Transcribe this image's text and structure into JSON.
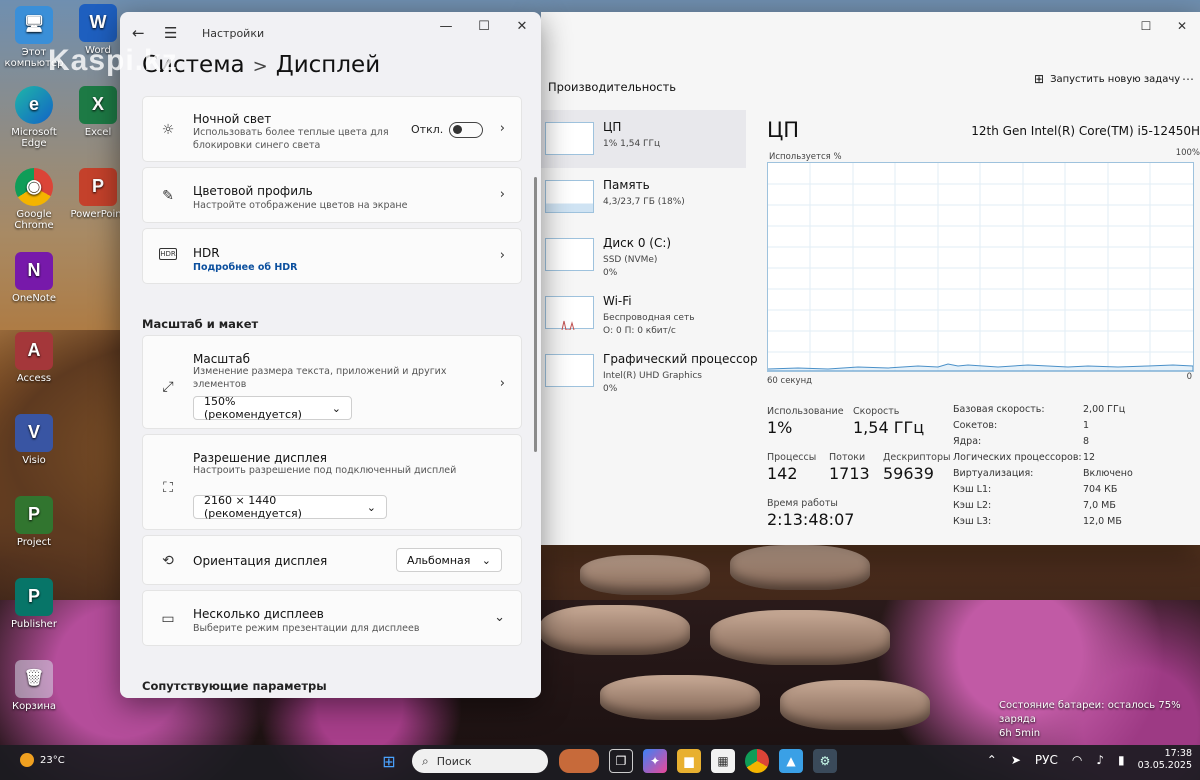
{
  "desktop": {
    "icons": [
      {
        "label": "Этот компьютер",
        "glyph": "🖥"
      },
      {
        "label": "Word",
        "glyph": "W"
      },
      {
        "label": "Microsoft Edge",
        "glyph": "e"
      },
      {
        "label": "Excel",
        "glyph": "X"
      },
      {
        "label": "Google Chrome",
        "glyph": "◉"
      },
      {
        "label": "PowerPoint",
        "glyph": "P"
      },
      {
        "label": "OneNote",
        "glyph": "N"
      },
      {
        "label": "Access",
        "glyph": "A"
      },
      {
        "label": "Visio",
        "glyph": "V"
      },
      {
        "label": "Project",
        "glyph": "P"
      },
      {
        "label": "Publisher",
        "glyph": "P"
      },
      {
        "label": "Корзина",
        "glyph": "🗑"
      }
    ],
    "watermark": "Kaspi.kz"
  },
  "settings": {
    "window_title": "Настройки",
    "breadcrumb_parent": "Система",
    "breadcrumb_sep": ">",
    "breadcrumb_current": "Дисплей",
    "night_light": {
      "title": "Ночной свет",
      "desc": "Использовать более теплые цвета для блокировки синего света",
      "state": "Откл."
    },
    "color_profile": {
      "title": "Цветовой профиль",
      "desc": "Настройте отображение цветов на экране"
    },
    "hdr": {
      "title": "HDR",
      "link": "Подробнее об HDR"
    },
    "section_scale": "Масштаб и макет",
    "scale": {
      "title": "Масштаб",
      "desc": "Изменение размера текста, приложений и других элементов",
      "value": "150% (рекомендуется)"
    },
    "resolution": {
      "title": "Разрешение дисплея",
      "desc": "Настроить разрешение под подключенный дисплей",
      "value": "2160 × 1440 (рекомендуется)"
    },
    "orientation": {
      "title": "Ориентация дисплея",
      "value": "Альбомная"
    },
    "multi": {
      "title": "Несколько дисплеев",
      "desc": "Выберите режим презентации для дисплеев"
    },
    "section_related": "Сопутствующие параметры"
  },
  "taskmgr": {
    "tab_title": "Производительность",
    "run_task": "Запустить новую задачу",
    "resources": [
      {
        "name": "ЦП",
        "sub1": "1% 1,54 ГГц",
        "sub2": ""
      },
      {
        "name": "Память",
        "sub1": "4,3/23,7 ГБ (18%)",
        "sub2": ""
      },
      {
        "name": "Диск 0 (C:)",
        "sub1": "SSD (NVMe)",
        "sub2": "0%"
      },
      {
        "name": "Wi-Fi",
        "sub1": "Беспроводная сеть",
        "sub2": "О: 0 П: 0 кбит/с"
      },
      {
        "name": "Графический процессор",
        "sub1": "Intel(R) UHD Graphics",
        "sub2": "0%"
      }
    ],
    "cpu": {
      "title": "ЦП",
      "model": "12th Gen Intel(R) Core(TM) i5-12450H",
      "util_label": "Используется %",
      "util_max": "100%",
      "x_left": "60 секунд",
      "x_right": "0",
      "stats": {
        "usage_label": "Использование",
        "usage": "1%",
        "speed_label": "Скорость",
        "speed": "1,54 ГГц",
        "proc_label": "Процессы",
        "proc": "142",
        "threads_label": "Потоки",
        "threads": "1713",
        "handles_label": "Дескрипторы",
        "handles": "59639",
        "uptime_label": "Время работы",
        "uptime": "2:13:48:07"
      },
      "details": [
        {
          "k": "Базовая скорость:",
          "v": "2,00 ГГц"
        },
        {
          "k": "Сокетов:",
          "v": "1"
        },
        {
          "k": "Ядра:",
          "v": "8"
        },
        {
          "k": "Логических процессоров:",
          "v": "12"
        },
        {
          "k": "Виртуализация:",
          "v": "Включено"
        },
        {
          "k": "Кэш L1:",
          "v": "704 КБ"
        },
        {
          "k": "Кэш L2:",
          "v": "7,0 МБ"
        },
        {
          "k": "Кэш L3:",
          "v": "12,0 МБ"
        }
      ]
    }
  },
  "notification": {
    "line1": "Состояние батареи: осталось 75% заряда",
    "line2": "6h 5min"
  },
  "taskbar": {
    "weather": "23°C",
    "search_placeholder": "Поиск",
    "lang": "РУС",
    "time": "17:38",
    "date": "03.05.2025"
  }
}
